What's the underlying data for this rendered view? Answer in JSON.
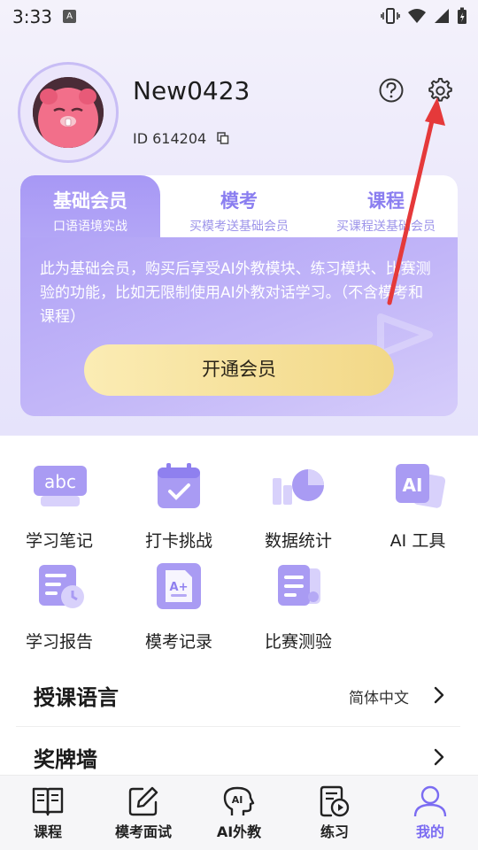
{
  "status_bar": {
    "time": "3:33",
    "notification_badge": "A"
  },
  "profile": {
    "username": "New0423",
    "user_id": "ID 614204",
    "icons": {
      "copy": "copy-icon",
      "help": "help-icon",
      "settings": "gear-icon"
    }
  },
  "membership": {
    "tabs": [
      {
        "title": "基础会员",
        "subtitle": "口语语境实战"
      },
      {
        "title": "模考",
        "subtitle": "买模考送基础会员"
      },
      {
        "title": "课程",
        "subtitle": "买课程送基础会员"
      }
    ],
    "description": "此为基础会员，购买后享受AI外教模块、练习模块、比赛测验的功能，比如无限制使用AI外教对话学习。（不含模考和课程）",
    "button_label": "开通会员"
  },
  "grid": [
    {
      "label": "学习笔记",
      "icon": "notes-abc-icon"
    },
    {
      "label": "打卡挑战",
      "icon": "calendar-check-icon"
    },
    {
      "label": "数据统计",
      "icon": "stats-chart-icon"
    },
    {
      "label": "AI 工具",
      "icon": "ai-tool-icon"
    },
    {
      "label": "学习报告",
      "icon": "report-icon"
    },
    {
      "label": "模考记录",
      "icon": "exam-record-icon"
    },
    {
      "label": "比赛测验",
      "icon": "contest-icon"
    }
  ],
  "settings": {
    "language": {
      "title": "授课语言",
      "value": "简体中文"
    },
    "medals": {
      "title": "奖牌墙"
    }
  },
  "bottom_nav": [
    {
      "label": "课程",
      "icon": "book-icon"
    },
    {
      "label": "模考面试",
      "icon": "edit-icon"
    },
    {
      "label": "AI外教",
      "icon": "ai-head-icon"
    },
    {
      "label": "练习",
      "icon": "practice-icon"
    },
    {
      "label": "我的",
      "icon": "profile-icon"
    }
  ],
  "colors": {
    "accent": "#7b6cf2",
    "card_purple": "#a798f5",
    "button_gold": "#f2d887",
    "annotation_red": "#e5393a"
  }
}
